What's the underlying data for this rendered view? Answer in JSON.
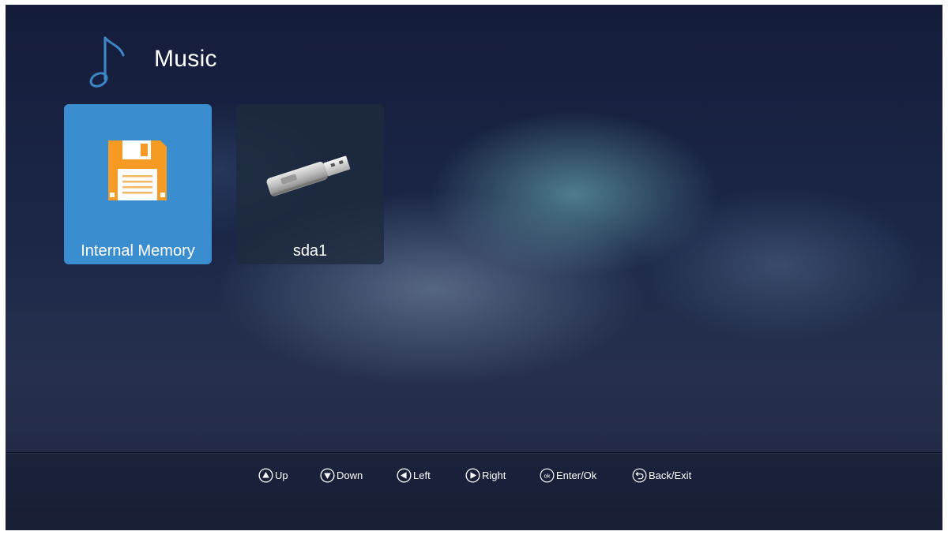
{
  "header": {
    "title": "Music",
    "icon": "music-note-icon"
  },
  "tiles": [
    {
      "label": "Internal Memory",
      "icon": "floppy-disk-icon",
      "selected": true,
      "color": "#3a8ed0"
    },
    {
      "label": "sda1",
      "icon": "usb-drive-icon",
      "selected": false
    }
  ],
  "footer": {
    "hints": [
      {
        "label": "Up",
        "icon": "up-arrow-circle-icon"
      },
      {
        "label": "Down",
        "icon": "down-arrow-circle-icon"
      },
      {
        "label": "Left",
        "icon": "left-arrow-circle-icon"
      },
      {
        "label": "Right",
        "icon": "right-arrow-circle-icon"
      },
      {
        "label": "Enter/Ok",
        "icon": "ok-circle-icon",
        "icon_text": "ok"
      },
      {
        "label": "Back/Exit",
        "icon": "back-circle-icon"
      }
    ]
  },
  "colors": {
    "accent": "#3a8ed0",
    "music_icon": "#3d86c6",
    "floppy": "#f59a23"
  }
}
